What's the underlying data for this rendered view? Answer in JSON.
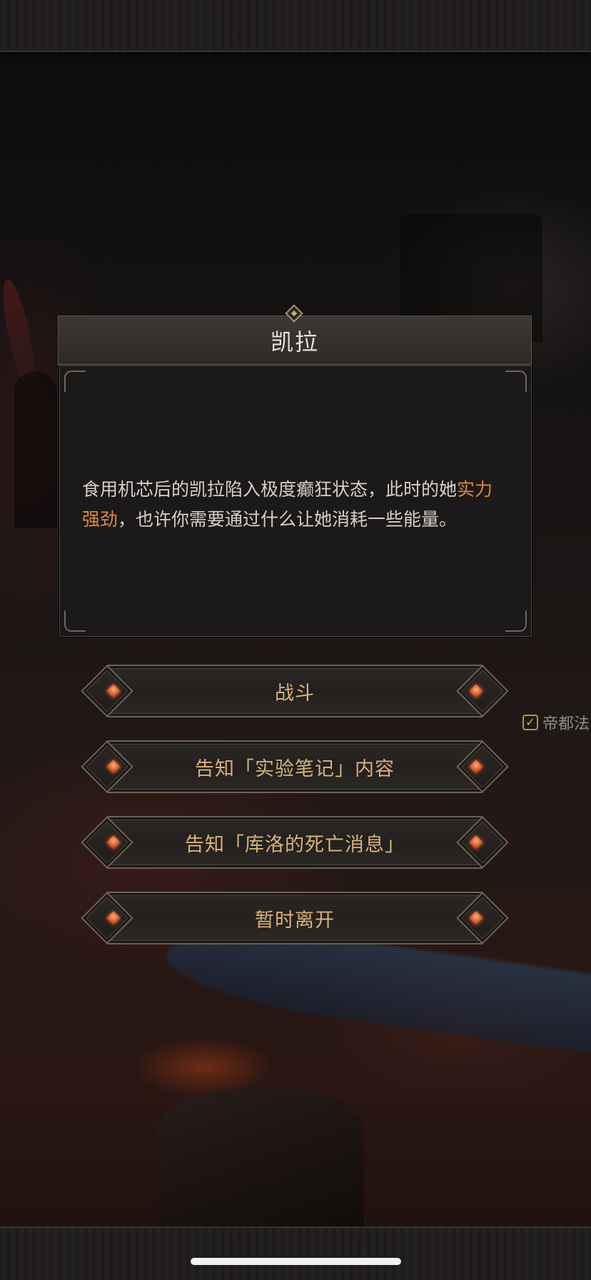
{
  "dialog": {
    "title": "凯拉",
    "text_part1": "食用机芯后的凯拉陷入极度癫狂状态，此时的她",
    "text_highlight": "实力强劲",
    "text_part2": "，也许你需要通过什么让她消耗一些能量。",
    "highlight_color": "#e08a3a"
  },
  "choices": [
    {
      "label": "战斗"
    },
    {
      "label": "告知「实验笔记」内容"
    },
    {
      "label": "告知「库洛的死亡消息」"
    },
    {
      "label": "暂时离开"
    }
  ],
  "side_quest": {
    "label": "帝都法",
    "icon": "checkbox-checked-icon"
  }
}
